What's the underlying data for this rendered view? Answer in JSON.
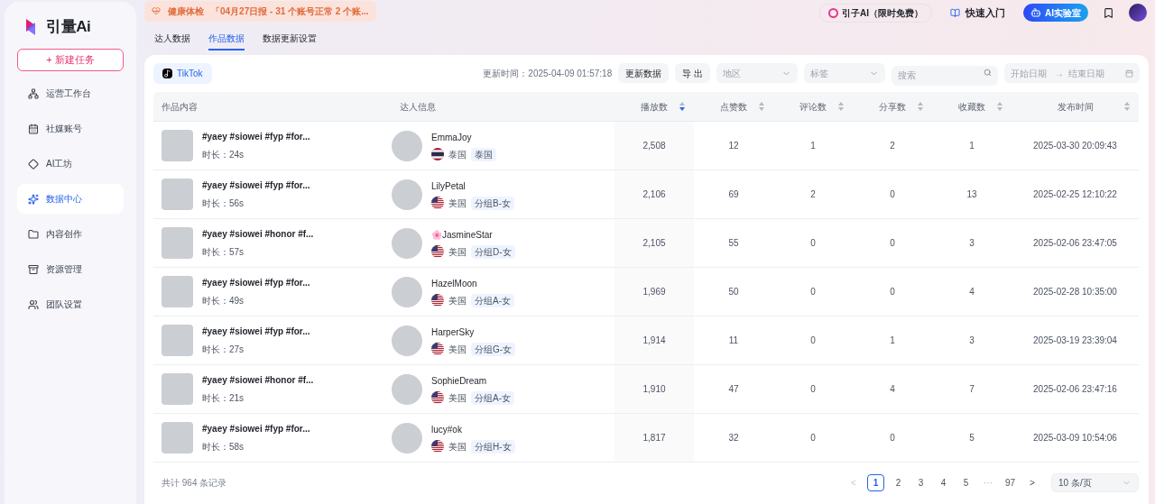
{
  "logo": {
    "text": "引量Ai"
  },
  "new_task": "+ 新建任务",
  "sidebar": {
    "items": [
      {
        "label": "运营工作台",
        "selected": false
      },
      {
        "label": "社媒账号",
        "selected": false
      },
      {
        "label": "AI工坊",
        "selected": false
      },
      {
        "label": "数据中心",
        "selected": true
      },
      {
        "label": "内容创作",
        "selected": false
      },
      {
        "label": "资源管理",
        "selected": false
      },
      {
        "label": "团队设置",
        "selected": false
      }
    ]
  },
  "notice": {
    "label": "健康体检",
    "text": "「04月27日报 - 31 个账号正常 2 个账..."
  },
  "header": {
    "ai_promo": "引子AI（限时免费）",
    "quick_start": "快速入门",
    "ai_lab": "AI实验室"
  },
  "tabs": [
    {
      "label": "达人数据",
      "selected": false
    },
    {
      "label": "作品数据",
      "selected": true
    },
    {
      "label": "数据更新设置",
      "selected": false
    }
  ],
  "platform": "TikTok",
  "toolbar": {
    "updated": "更新时间：2025-04-09 01:57:18",
    "refresh": "更新数据",
    "export": "导 出",
    "region": {
      "placeholder": "地区"
    },
    "tag": {
      "placeholder": "标签"
    },
    "search": {
      "placeholder": "搜索"
    },
    "start_date": {
      "placeholder": "开始日期"
    },
    "date_separator": "→",
    "end_date": {
      "placeholder": "结束日期"
    }
  },
  "table": {
    "columns": [
      {
        "label": "作品内容",
        "kind": "plain"
      },
      {
        "label": "达人信息",
        "kind": "plain"
      },
      {
        "label": "播放数",
        "kind": "sortable",
        "sorted": true
      },
      {
        "label": "点赞数",
        "kind": "sortable",
        "sorted": false
      },
      {
        "label": "评论数",
        "kind": "sortable",
        "sorted": false
      },
      {
        "label": "分享数",
        "kind": "sortable",
        "sorted": false
      },
      {
        "label": "收藏数",
        "kind": "sortable",
        "sorted": false
      },
      {
        "label": "发布时间",
        "kind": "sortable",
        "sorted": false
      }
    ],
    "rows": [
      {
        "title": "#yaey #siowei #fyp #for...",
        "duration": "时长：24s",
        "creator": "EmmaJoy",
        "kind": "thailand",
        "country": "泰国",
        "group": "泰国",
        "plays": "2,508",
        "likes": "12",
        "comments": "1",
        "shares": "2",
        "favorites": "1",
        "published": "2025-03-30 20:09:43"
      },
      {
        "title": "#yaey #siowei #fyp #for...",
        "duration": "时长：56s",
        "creator": "LilyPetal",
        "kind": "usa",
        "country": "美国",
        "group": "分组B-女",
        "plays": "2,106",
        "likes": "69",
        "comments": "2",
        "shares": "0",
        "favorites": "13",
        "published": "2025-02-25 12:10:22"
      },
      {
        "title": "#yaey #siowei #honor #f...",
        "duration": "时长：57s",
        "creator": "🌸JasmineStar",
        "kind": "usa",
        "country": "美国",
        "group": "分组D-女",
        "plays": "2,105",
        "likes": "55",
        "comments": "0",
        "shares": "0",
        "favorites": "3",
        "published": "2025-02-06 23:47:05"
      },
      {
        "title": "#yaey #siowei #fyp #for...",
        "duration": "时长：49s",
        "creator": "HazelMoon",
        "kind": "usa",
        "country": "美国",
        "group": "分组A-女",
        "plays": "1,969",
        "likes": "50",
        "comments": "0",
        "shares": "0",
        "favorites": "4",
        "published": "2025-02-28 10:35:00"
      },
      {
        "title": "#yaey #siowei #fyp #for...",
        "duration": "时长：27s",
        "creator": "HarperSky",
        "kind": "usa",
        "country": "美国",
        "group": "分组G-女",
        "plays": "1,914",
        "likes": "11",
        "comments": "0",
        "shares": "1",
        "favorites": "3",
        "published": "2025-03-19 23:39:04"
      },
      {
        "title": "#yaey #siowei #honor #f...",
        "duration": "时长：21s",
        "creator": "SophieDream",
        "kind": "usa",
        "country": "美国",
        "group": "分组A-女",
        "plays": "1,910",
        "likes": "47",
        "comments": "0",
        "shares": "4",
        "favorites": "7",
        "published": "2025-02-06 23:47:16"
      },
      {
        "title": "#yaey #siowei #fyp #for...",
        "duration": "时长：58s",
        "creator": "lucy#ok",
        "kind": "usa",
        "country": "美国",
        "group": "分组H-女",
        "plays": "1,817",
        "likes": "32",
        "comments": "0",
        "shares": "0",
        "favorites": "5",
        "published": "2025-03-09 10:54:06"
      }
    ]
  },
  "footer": {
    "total": "共计 964 条记录",
    "prev": "<",
    "next": ">",
    "ellipsis": "···",
    "pages": [
      {
        "label": "1",
        "selected": true
      },
      {
        "label": "2",
        "selected": false
      },
      {
        "label": "3",
        "selected": false
      },
      {
        "label": "4",
        "selected": false
      },
      {
        "label": "5",
        "selected": false
      },
      {
        "label": "97",
        "selected": false
      }
    ],
    "page_size": "10 条/页"
  }
}
